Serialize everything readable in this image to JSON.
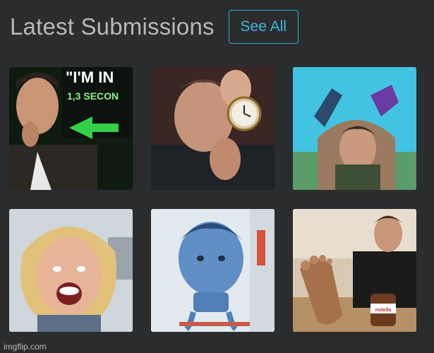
{
  "header": {
    "title": "Latest Submissions",
    "see_all_label": "See All"
  },
  "thumbnails": [
    {
      "overlay_line1": "\"I'M IN",
      "overlay_line2": "1,3 SECON"
    },
    {},
    {},
    {},
    {},
    {
      "jar_label": "nutella"
    }
  ],
  "watermark": "imgflip.com",
  "colors": {
    "background": "#2b2c2e",
    "accent": "#2ea8c9",
    "title": "#b7b8ba"
  }
}
